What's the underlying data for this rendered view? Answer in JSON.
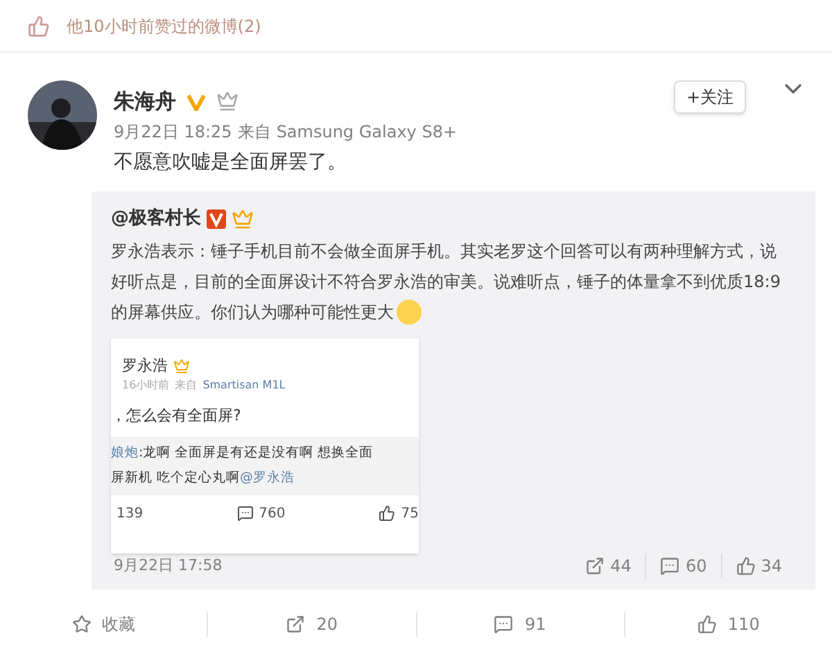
{
  "liked_header": {
    "text": "他10小时前赞过的微博(2)"
  },
  "post": {
    "author": "朱海舟",
    "verified": true,
    "time": "9月22日 18:25",
    "source_prefix": "来自",
    "source": "Samsung Galaxy S8+",
    "follow_button": "+关注",
    "text": "不愿意吹嘘是全面屏罢了。"
  },
  "repost": {
    "author": "@极客村长",
    "verified": true,
    "text": "罗永浩表示：锤子手机目前不会做全面屏手机。其实老罗这个回答可以有两种理解方式，说好听点是，目前的全面屏设计不符合罗永浩的审美。说难听点，锤子的体量拿不到优质18:9的屏幕供应。你们认为哪种可能性更大",
    "screenshot": {
      "author": "罗永浩",
      "time": "16小时前",
      "source_prefix": "来自",
      "source": "Smartisan M1L",
      "text": "，怎么会有全面屏?",
      "quote_user": "娘炮",
      "quote_text": ":龙啊 全面屏是有还是没有啊 想换全面屏新机 吃个定心丸啊",
      "quote_mention": "@罗永浩",
      "counts": [
        "139",
        "760",
        "75"
      ]
    },
    "time": "9月22日 17:58",
    "counts": [
      {
        "kind": "share",
        "value": "44"
      },
      {
        "kind": "comment",
        "value": "60"
      },
      {
        "kind": "like",
        "value": "34"
      }
    ]
  },
  "actions": [
    {
      "kind": "favorite",
      "label": "收藏"
    },
    {
      "kind": "share",
      "label": "20"
    },
    {
      "kind": "comment",
      "label": "91"
    },
    {
      "kind": "like",
      "label": "110"
    }
  ]
}
